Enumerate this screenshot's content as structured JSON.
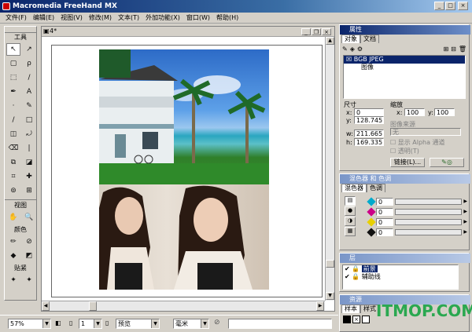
{
  "window": {
    "title": "Macromedia FreeHand MX"
  },
  "menu": [
    "文件(F)",
    "编辑(E)",
    "视图(V)",
    "修改(M)",
    "文本(T)",
    "外加功能(X)",
    "窗口(W)",
    "帮助(H)"
  ],
  "toolbox": {
    "title": "工具",
    "tools": [
      {
        "icon": "pointer-icon",
        "glyph": "↖"
      },
      {
        "icon": "subselect-icon",
        "glyph": "↗"
      },
      {
        "icon": "page-tool-icon",
        "glyph": "▢"
      },
      {
        "icon": "lasso-icon",
        "glyph": "ρ"
      },
      {
        "icon": "scale-icon",
        "glyph": "⬚"
      },
      {
        "icon": "eyedropper-icon",
        "glyph": "/"
      },
      {
        "icon": "pen-icon",
        "glyph": "✒"
      },
      {
        "icon": "text-icon",
        "glyph": "A"
      },
      {
        "icon": "bezigon-icon",
        "glyph": "·"
      },
      {
        "icon": "pencil-icon",
        "glyph": "✎"
      },
      {
        "icon": "line-icon",
        "glyph": "/"
      },
      {
        "icon": "rectangle-icon",
        "glyph": "□"
      },
      {
        "icon": "transform-icon",
        "glyph": "◫"
      },
      {
        "icon": "knife-icon",
        "glyph": "⤾"
      },
      {
        "icon": "eraser-icon",
        "glyph": "⌫"
      },
      {
        "icon": "brush-icon",
        "glyph": "❘"
      },
      {
        "icon": "mirror-icon",
        "glyph": "⧉"
      },
      {
        "icon": "freeform-icon",
        "glyph": "◪"
      },
      {
        "icon": "crop-icon",
        "glyph": "⌗"
      },
      {
        "icon": "paint-icon",
        "glyph": "✚"
      },
      {
        "icon": "blend-icon",
        "glyph": "⊚"
      },
      {
        "icon": "connector-icon",
        "glyph": "⊞"
      }
    ],
    "view_label": "视图",
    "view_tools": [
      {
        "icon": "hand-icon",
        "glyph": "✋"
      },
      {
        "icon": "zoom-icon",
        "glyph": "🔍"
      }
    ],
    "color_label": "颜色",
    "color_tools": [
      {
        "icon": "stroke-color-icon",
        "glyph": "✏"
      },
      {
        "icon": "no-color-icon",
        "glyph": "⊘"
      },
      {
        "icon": "fill-color-icon",
        "glyph": "◆"
      },
      {
        "icon": "swap-color-icon",
        "glyph": "◩"
      }
    ],
    "snap_label": "贴紧",
    "snap_tools": [
      {
        "icon": "snap-point-icon",
        "glyph": "✦"
      },
      {
        "icon": "snap-guide-icon",
        "glyph": "✦"
      }
    ]
  },
  "document": {
    "title": "4*"
  },
  "statusbar": {
    "zoom": "57%",
    "page": "1",
    "view_mode": "预览",
    "units": "毫米"
  },
  "properties_panel": {
    "title": "属性",
    "tabs": [
      "对象",
      "文档"
    ],
    "list": [
      {
        "label": "BGB JPEG",
        "selected": true
      },
      {
        "label": "图像",
        "selected": false
      }
    ],
    "dimensions_label": "尺寸",
    "x_label": "x:",
    "x_value": "0",
    "y_label": "y:",
    "y_value": "128.745",
    "w_label": "w:",
    "w_value": "211.665",
    "h_label": "h:",
    "h_value": "169.335",
    "scale_label": "缩放",
    "sx_label": "x:",
    "sx_value": "100",
    "sy_label": "y:",
    "sy_value": "100",
    "image_source_label": "图像来源",
    "image_source_value": "无",
    "alpha_label": "显示 Alpha 通道",
    "transparent_label": "透明(T)",
    "link_button": "链接(L)..."
  },
  "mixer_panel": {
    "title": "混色器 和 色调",
    "tabs": [
      "混色器",
      "色调"
    ],
    "rows": [
      {
        "icon": "cyan-icon",
        "color": "#00aacc",
        "value": "0"
      },
      {
        "icon": "magenta-icon",
        "color": "#cc0088",
        "value": "0"
      },
      {
        "icon": "yellow-icon",
        "color": "#e8d000",
        "value": "0"
      },
      {
        "icon": "black-icon",
        "color": "#111111",
        "value": "0"
      }
    ]
  },
  "layers_panel": {
    "title": "层",
    "layers": [
      {
        "label": "前景",
        "selected": true
      },
      {
        "label": "辅助线",
        "selected": false
      }
    ]
  },
  "swatches_panel": {
    "title": "资源",
    "tabs": [
      "样本",
      "样式"
    ]
  },
  "watermark": "ITMOP.COM"
}
